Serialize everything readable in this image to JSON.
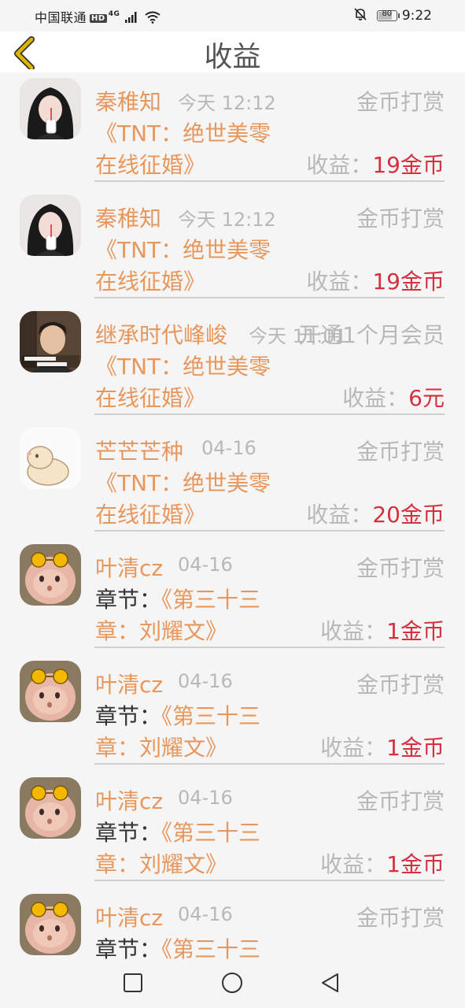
{
  "status_bar": {
    "carrier": "中国联通",
    "hd": "HD",
    "network": "4G",
    "battery": "80",
    "battery_level": 0.8,
    "time": "9:22"
  },
  "header": {
    "title": "收益"
  },
  "items": [
    {
      "nickname": "秦稚知",
      "time": "今天 12:12",
      "type": "金币打赏",
      "line1_prefix": "",
      "line1": "《TNT：绝世美零",
      "line2": "在线征婚》",
      "earn_label": "收益：",
      "earn_value": "19金币"
    },
    {
      "nickname": "秦稚知",
      "time": "今天 12:12",
      "type": "金币打赏",
      "line1_prefix": "",
      "line1": "《TNT：绝世美零",
      "line2": "在线征婚》",
      "earn_label": "收益：",
      "earn_value": "19金币"
    },
    {
      "nickname": "继承时代峰峻",
      "time": "今天 11:01",
      "type": "开通1个月会员",
      "line1_prefix": "",
      "line1": "《TNT：绝世美零",
      "line2": "在线征婚》",
      "earn_label": "收益：",
      "earn_value": "6元"
    },
    {
      "nickname": "芒芒芒种",
      "time": "04-16",
      "type": "金币打赏",
      "line1_prefix": "",
      "line1": "《TNT：绝世美零",
      "line2": "在线征婚》",
      "earn_label": "收益：",
      "earn_value": "20金币"
    },
    {
      "nickname": "叶清cz",
      "time": "04-16",
      "type": "金币打赏",
      "line1_prefix": "章节：",
      "line1": "《第三十三",
      "line2": "章：刘耀文》",
      "earn_label": "收益：",
      "earn_value": "1金币"
    },
    {
      "nickname": "叶清cz",
      "time": "04-16",
      "type": "金币打赏",
      "line1_prefix": "章节：",
      "line1": "《第三十三",
      "line2": "章：刘耀文》",
      "earn_label": "收益：",
      "earn_value": "1金币"
    },
    {
      "nickname": "叶清cz",
      "time": "04-16",
      "type": "金币打赏",
      "line1_prefix": "章节：",
      "line1": "《第三十三",
      "line2": "章：刘耀文》",
      "earn_label": "收益：",
      "earn_value": "1金币"
    },
    {
      "nickname": "叶清cz",
      "time": "04-16",
      "type": "金币打赏",
      "line1_prefix": "章节：",
      "line1": "《第三十三",
      "line2": "",
      "earn_label": "",
      "earn_value": ""
    }
  ],
  "colors": {
    "name_orange": "#e8975c",
    "earn_red": "#d6303f",
    "muted_gray": "#b8b8b8",
    "back_arrow_gold": "#e0b400"
  },
  "icons": {
    "back": "chevron-left-icon",
    "nav_recents": "square-icon",
    "nav_home": "circle-icon",
    "nav_back": "triangle-back-icon"
  }
}
